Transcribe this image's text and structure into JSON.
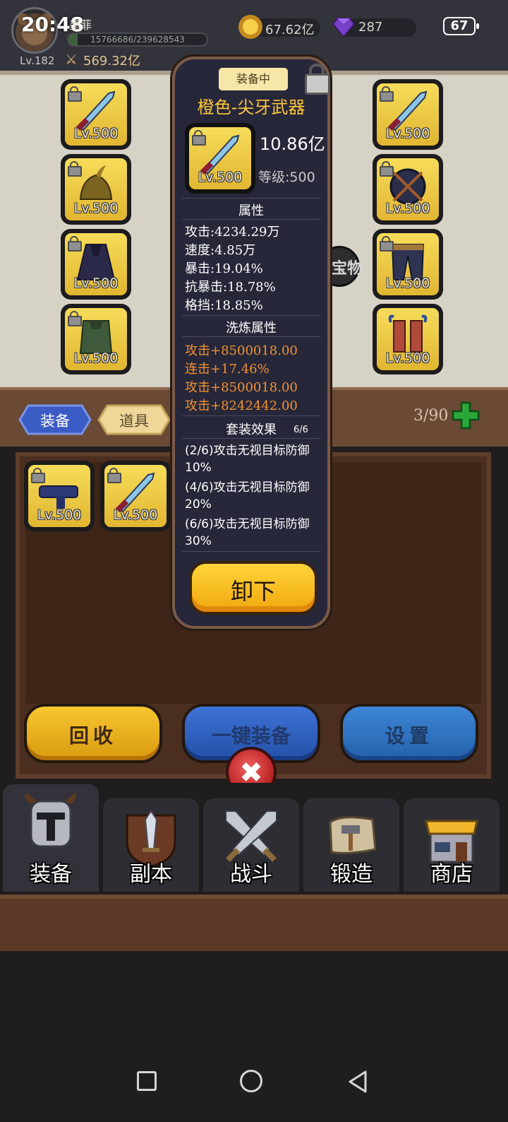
{
  "status_bar": {
    "time": "20:48",
    "battery": "67"
  },
  "player": {
    "name": "墨菲",
    "xp_text": "15766686/239628543",
    "xp_fraction": 0.066,
    "level": "Lv.182",
    "power": "569.32亿"
  },
  "currency": {
    "gold": "67.62亿",
    "gems": "287"
  },
  "equipped_slots": [
    {
      "level": "Lv.500",
      "item": "weapon"
    },
    {
      "level": "Lv.500",
      "item": "helmet"
    },
    {
      "level": "Lv.500",
      "item": "cloak"
    },
    {
      "level": "Lv.500",
      "item": "armor"
    },
    {
      "level": "Lv.500",
      "item": "weapon"
    },
    {
      "level": "Lv.500",
      "item": "shield"
    },
    {
      "level": "Lv.500",
      "item": "pants"
    },
    {
      "level": "Lv.500",
      "item": "boots"
    }
  ],
  "bag_toggle_label": "宝物",
  "tabs": [
    {
      "label": "装备"
    },
    {
      "label": "道具"
    }
  ],
  "bag": {
    "count": "3/90",
    "items": [
      {
        "level": "Lv.500",
        "item": "gun"
      },
      {
        "level": "Lv.500",
        "item": "weapon"
      }
    ]
  },
  "actions": {
    "recycle": "回收",
    "auto_equip": "一键装备",
    "settings": "设置"
  },
  "bottom_nav": [
    {
      "label": "装备",
      "icon": "helmet-icon"
    },
    {
      "label": "副本",
      "icon": "dungeon-icon"
    },
    {
      "label": "战斗",
      "icon": "crossed-swords-icon"
    },
    {
      "label": "锻造",
      "icon": "scroll-hammer-icon"
    },
    {
      "label": "商店",
      "icon": "shop-icon"
    }
  ],
  "popup": {
    "badge": "装备中",
    "title": "橙色-尖牙武器",
    "item_level": "Lv.500",
    "power": "10.86亿",
    "grade": "等级:500",
    "attributes_title": "属性",
    "attributes": [
      "攻击:4234.29万",
      "速度:4.85万",
      "暴击:19.04%",
      "抗暴击:18.78%",
      "格挡:18.85%"
    ],
    "refine_title": "洗炼属性",
    "refine": [
      "攻击+8500018.00",
      "连击+17.46%",
      "攻击+8500018.00",
      "攻击+8242442.00"
    ],
    "set_title": "套装效果",
    "set_count": "6/6",
    "set_effects": [
      "(2/6)攻击无视目标防御10%",
      "(4/6)攻击无视目标防御20%",
      "(6/6)攻击无视目标防御30%"
    ],
    "unequip": "卸下"
  },
  "colors": {
    "accent_gold": "#ffc73a",
    "refine_orange": "#f2922f",
    "item_yellow": "#f6dc5a"
  }
}
